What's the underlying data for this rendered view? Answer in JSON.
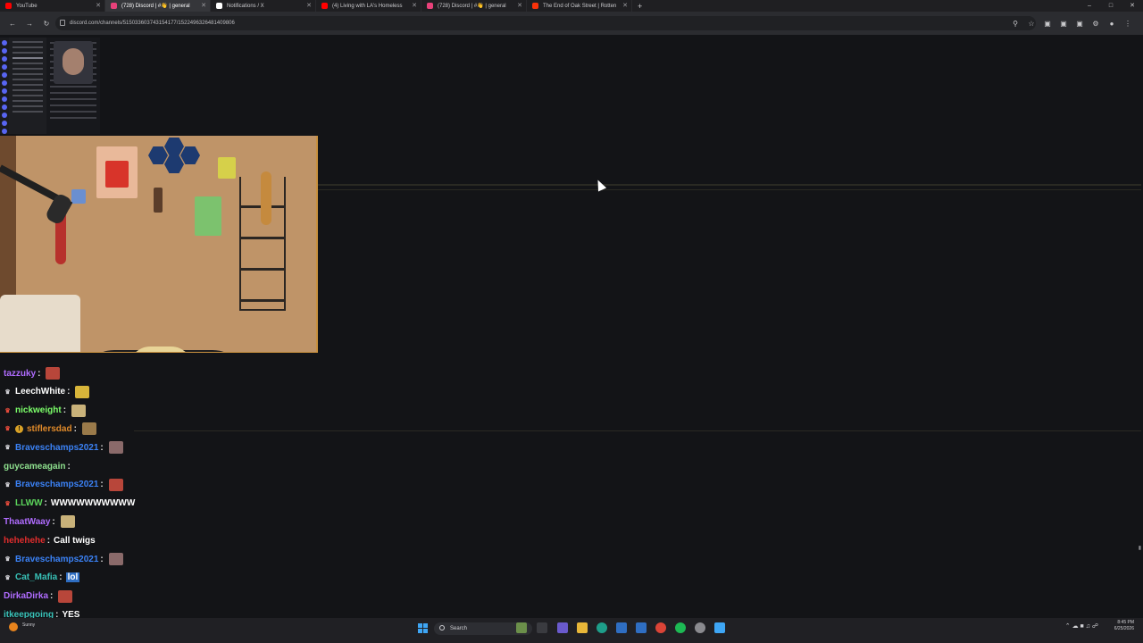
{
  "browser": {
    "tabs": [
      {
        "title": "YouTube",
        "favicon_color": "#ff0000",
        "active": false
      },
      {
        "title": "(728) Discord | #👋 | general",
        "favicon_color": "#e8417a",
        "active": true
      },
      {
        "title": "Notifications / X",
        "favicon_color": "#ffffff",
        "active": false
      },
      {
        "title": "(4) Living with LA's Homeless",
        "favicon_color": "#ff0000",
        "active": false
      },
      {
        "title": "(728) Discord | #👋 | general",
        "favicon_color": "#e8417a",
        "active": false
      },
      {
        "title": "The End of Oak Street | Rotten",
        "favicon_color": "#fa320a",
        "active": false
      }
    ],
    "url": "discord.com/channels/515033603743154177/1522496326481409806"
  },
  "chat": [
    {
      "name": "tazzuky",
      "color": "#b06cff",
      "badges": [],
      "text": "",
      "emote": true
    },
    {
      "name": "LeechWhite",
      "color": "#ffffff",
      "badges": [
        "crown"
      ],
      "text": "",
      "emote": true
    },
    {
      "name": "nickweight",
      "color": "#7cff6a",
      "badges": [
        "red"
      ],
      "text": "",
      "emote": true
    },
    {
      "name": "stiflersdad",
      "color": "#e08a2a",
      "badges": [
        "red",
        "gold"
      ],
      "text": "",
      "emote": true
    },
    {
      "name": "Braveschamps2021",
      "color": "#3b82f6",
      "badges": [
        "crown"
      ],
      "text": "",
      "emote": true
    },
    {
      "name": "guycameagain",
      "color": "#8fe18f",
      "badges": [],
      "text": "",
      "emote": false
    },
    {
      "name": "Braveschamps2021",
      "color": "#3b82f6",
      "badges": [
        "crown"
      ],
      "text": "",
      "emote": true
    },
    {
      "name": "LLWW",
      "color": "#5cd65c",
      "badges": [
        "red"
      ],
      "text": "WWWWWWWWWW",
      "emote": false
    },
    {
      "name": "ThaatWaay",
      "color": "#b06cff",
      "badges": [],
      "text": "",
      "emote": true
    },
    {
      "name": "hehehehe",
      "color": "#e02d2d",
      "badges": [],
      "text": "Call twigs",
      "emote": false
    },
    {
      "name": "Braveschamps2021",
      "color": "#3b82f6",
      "badges": [
        "crown"
      ],
      "text": "",
      "emote": true
    },
    {
      "name": "Cat_Mafia",
      "color": "#38c2b8",
      "badges": [
        "crown"
      ],
      "text": "lol",
      "emote": false,
      "boxed": true
    },
    {
      "name": "DirkaDirka",
      "color": "#b06cff",
      "badges": [],
      "text": "",
      "emote": true
    },
    {
      "name": "itkeepgoing",
      "color": "#38c2b8",
      "badges": [],
      "text": "YES",
      "emote": false
    }
  ],
  "taskbar": {
    "search_placeholder": "Search",
    "time": "8:45 PM",
    "date": "6/25/2026",
    "weather": "Sunny"
  }
}
